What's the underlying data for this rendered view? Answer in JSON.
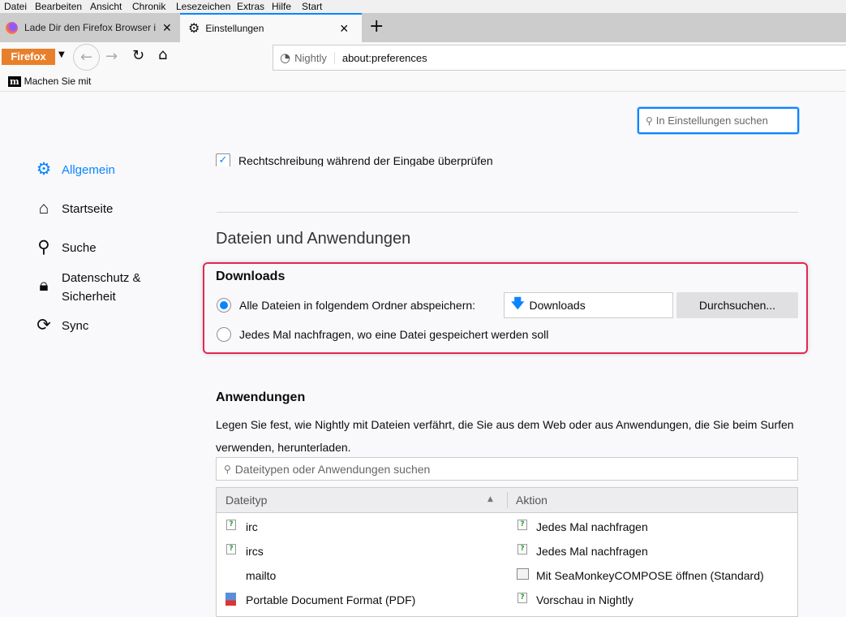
{
  "menu": [
    "Datei",
    "Bearbeiten",
    "Ansicht",
    "Chronik",
    "Lesezeichen",
    "Extras",
    "Hilfe",
    "Start"
  ],
  "tabs": [
    {
      "label": "Lade Dir den Firefox Browser in"
    },
    {
      "label": "Einstellungen",
      "active": true
    }
  ],
  "nav": {
    "firefox_button": "Firefox",
    "identity": "Nightly",
    "url": "about:preferences"
  },
  "bookmarks": [
    {
      "label": "Machen Sie mit"
    }
  ],
  "search": {
    "placeholder": "In Einstellungen suchen"
  },
  "sidebar": [
    {
      "label": "Allgemein",
      "icon": "gear-icon",
      "active": true
    },
    {
      "label": "Startseite",
      "icon": "home-icon"
    },
    {
      "label": "Suche",
      "icon": "search-icon"
    },
    {
      "label": "Datenschutz & Sicherheit",
      "icon": "lock-icon"
    },
    {
      "label": "Sync",
      "icon": "sync-icon"
    }
  ],
  "spellcheck": {
    "label": "Rechtschreibung während der Eingabe überprüfen",
    "checked": true
  },
  "files": {
    "heading": "Dateien und Anwendungen",
    "downloads": {
      "heading": "Downloads",
      "save_label": "Alle Dateien in folgendem Ordner abspeichern:",
      "folder": "Downloads",
      "browse": "Durchsuchen...",
      "ask_label": "Jedes Mal nachfragen, wo eine Datei gespeichert werden soll",
      "selected": "save"
    },
    "apps": {
      "heading": "Anwendungen",
      "description": "Legen Sie fest, wie Nightly mit Dateien verfährt, die Sie aus dem Web oder aus Anwendungen, die Sie beim Surfen verwenden, herunterladen.",
      "search_placeholder": "Dateitypen oder Anwendungen suchen",
      "columns": [
        "Dateityp",
        "Aktion"
      ],
      "rows": [
        {
          "type": "irc",
          "action": "Jedes Mal nachfragen"
        },
        {
          "type": "ircs",
          "action": "Jedes Mal nachfragen"
        },
        {
          "type": "mailto",
          "action": "Mit SeaMonkeyCOMPOSE öffnen (Standard)"
        },
        {
          "type": "Portable Document Format (PDF)",
          "action": "Vorschau in Nightly"
        }
      ]
    }
  },
  "colors": {
    "accent": "#0a84ff",
    "highlight": "#e22850",
    "firefox_orange": "#e8802b"
  }
}
